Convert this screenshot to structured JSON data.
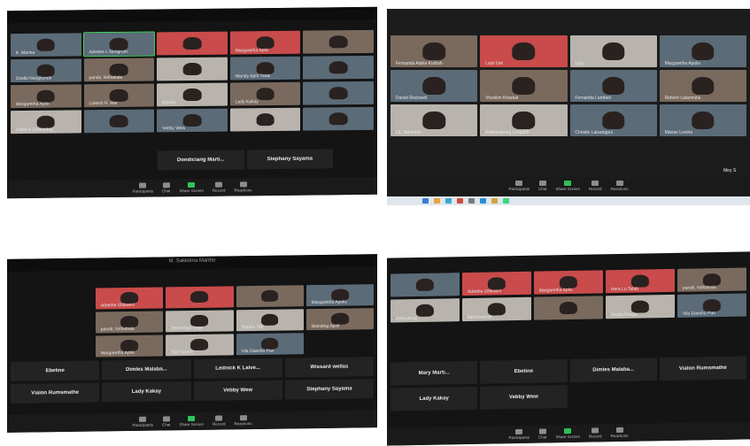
{
  "screenshots": {
    "top_left": {
      "tiles": [
        {
          "name": "K. Marina",
          "style": "video"
        },
        {
          "name": "Adrethe L Nongrum",
          "style": "video active"
        },
        {
          "name": "",
          "style": "video banner"
        },
        {
          "name": "Margaretha Aplin",
          "style": "video banner"
        },
        {
          "name": "",
          "style": "video warm"
        },
        {
          "name": "Dioditi Nongkynrih",
          "style": "video"
        },
        {
          "name": "pandit, Nrihabala",
          "style": "video warm"
        },
        {
          "name": "",
          "style": "video light"
        },
        {
          "name": "Wandy April Talab",
          "style": "video"
        },
        {
          "name": "",
          "style": "video"
        },
        {
          "name": "Margaretha Aplin",
          "style": "video warm"
        },
        {
          "name": "Lokesh R. Mar",
          "style": "video warm"
        },
        {
          "name": "Kimeia",
          "style": "video light"
        },
        {
          "name": "Lady Kakay",
          "style": "video warm"
        },
        {
          "name": "",
          "style": "video"
        },
        {
          "name": "Dahla K Damaning",
          "style": "video light"
        },
        {
          "name": "",
          "style": "video"
        },
        {
          "name": "Vebby Wew",
          "style": "video"
        },
        {
          "name": "",
          "style": "video light"
        },
        {
          "name": "",
          "style": "video"
        }
      ],
      "name_tiles": [
        "Dondiciang Marti...",
        "Stephany Sayama"
      ],
      "toolbar": [
        "Participants",
        "Chat",
        "Share Screen",
        "Record",
        "Reactions"
      ]
    },
    "top_right": {
      "tiles": [
        {
          "name": "Fernanda Adela Kurbah",
          "style": "video warm"
        },
        {
          "name": "Lock Unt",
          "style": "video banner"
        },
        {
          "name": "Lucy",
          "style": "video light"
        },
        {
          "name": "Margaretha Apolis",
          "style": "video"
        },
        {
          "name": "Daniel Rockwell",
          "style": "video"
        },
        {
          "name": "Vivekiim Kharkat",
          "style": "video warm"
        },
        {
          "name": "Fernanda Lambert",
          "style": "video"
        },
        {
          "name": "Reborn Lalanmina",
          "style": "video warm"
        },
        {
          "name": "LE, Nirmohin",
          "style": "video light"
        },
        {
          "name": "Rebhiiuteimg Lyngdoh",
          "style": "video light"
        },
        {
          "name": "Christie Lalsangpui",
          "style": "video"
        },
        {
          "name": "Marian Leviria",
          "style": "video"
        }
      ],
      "edge_label": "Mey S",
      "toolbar": [
        "Participants",
        "Chat",
        "Share Screen",
        "Record",
        "Reactions"
      ]
    },
    "bottom_left": {
      "title": "M. Sakkikria Marthe",
      "tiles": [
        {
          "name": "Adrethe Ullibuenl",
          "style": "video banner"
        },
        {
          "name": "",
          "style": "video banner"
        },
        {
          "name": "",
          "style": "video warm"
        },
        {
          "name": "Margaretha Apolis",
          "style": "video"
        },
        {
          "name": "pandit, Nrihabala",
          "style": "video warm"
        },
        {
          "name": "Debrothyo Rngs",
          "style": "video light"
        },
        {
          "name": "Tefenzi Tlib",
          "style": "video light"
        },
        {
          "name": "Wanding Apoll",
          "style": "video warm"
        },
        {
          "name": "Margaretha Aplin",
          "style": "video warm"
        },
        {
          "name": "Tipi Sakesh",
          "style": "video light"
        },
        {
          "name": "Vila Daesha Pan",
          "style": "video"
        }
      ],
      "name_tiles": [
        "Ebeline",
        "Dimles Malaba...",
        "Lednick K Lalve...",
        "Wissard wellas",
        "Vialon Rumsmathe",
        "Lady Kakay",
        "Vebby Wew",
        "Stephany Sayama"
      ],
      "toolbar": [
        "Participants",
        "Chat",
        "Share Screen",
        "Record",
        "Reactions"
      ]
    },
    "bottom_right": {
      "tiles": [
        {
          "name": "",
          "style": "video"
        },
        {
          "name": "Adrethe Ullibuenl",
          "style": "video banner"
        },
        {
          "name": "Margaretha Aplin",
          "style": "video banner"
        },
        {
          "name": "Hera Lu Talab",
          "style": "video banner"
        },
        {
          "name": "pandit, Nrihabala",
          "style": "video warm"
        },
        {
          "name": "Dehiiuteng",
          "style": "video light"
        },
        {
          "name": "Mel Kharsak",
          "style": "video light"
        },
        {
          "name": "",
          "style": "video warm"
        },
        {
          "name": "Dioditi Nongk",
          "style": "video light"
        },
        {
          "name": "Vila Daesha Pan",
          "style": "video"
        }
      ],
      "name_tiles": [
        "Mary Marti...",
        "Ebeline",
        "Dimles Malaba...",
        "Vialon Rumsmathe",
        "Lady Kakay",
        "Vebby Wew"
      ],
      "toolbar": [
        "Participants",
        "Chat",
        "Share Screen",
        "Record",
        "Reactions"
      ]
    }
  }
}
